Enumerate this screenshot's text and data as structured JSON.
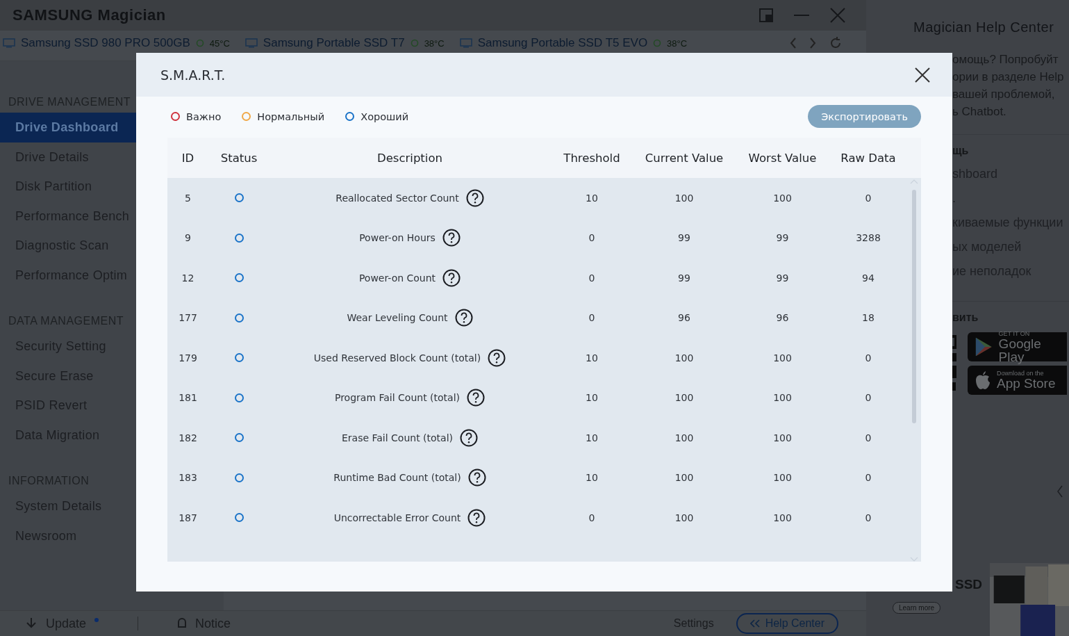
{
  "app": {
    "logo": "SAMSUNG Magician"
  },
  "drives": [
    {
      "name": "Samsung SSD 980 PRO 500GB",
      "temp": "45°C"
    },
    {
      "name": "Samsung Portable SSD T7",
      "temp": "38°C"
    },
    {
      "name": "Samsung Portable SSD T5 EVO",
      "temp": "38°C"
    }
  ],
  "sidebar": [
    {
      "heading": "DRIVE MANAGEMENT",
      "items": [
        {
          "label": "Drive Dashboard",
          "selected": true
        },
        {
          "label": "Drive Details",
          "selected": false
        },
        {
          "label": "Disk Partition",
          "selected": false
        },
        {
          "label": "Performance Bench",
          "selected": false
        },
        {
          "label": "Diagnostic Scan",
          "selected": false
        },
        {
          "label": "Performance Optim",
          "selected": false
        }
      ]
    },
    {
      "heading": "DATA MANAGEMENT",
      "items": [
        {
          "label": "Security Setting",
          "selected": false
        },
        {
          "label": "Secure Erase",
          "selected": false
        },
        {
          "label": "PSID Revert",
          "selected": false
        },
        {
          "label": "Data Migration",
          "selected": false
        }
      ]
    },
    {
      "heading": "INFORMATION",
      "items": [
        {
          "label": "System Details",
          "selected": false
        },
        {
          "label": "Newsroom",
          "selected": false
        }
      ]
    }
  ],
  "bottom_bar": {
    "update": "Update",
    "notice": "Notice",
    "settings": "Settings",
    "help_center": "Help Center"
  },
  "help_panel": {
    "title": "Magician Help Center",
    "intro": [
      "омощь? Попробуйт",
      "ории в разделе Help",
      "вашей проблемой,",
      "ь Chatbot."
    ],
    "section": "щь",
    "links": [
      "shboard",
      ".",
      "киваемые функции",
      "ых моделей",
      "ие неполадок"
    ],
    "install": "вить",
    "google_play": {
      "small": "GET IT ON",
      "big": "Google Play"
    },
    "app_store": {
      "small": "Download on the",
      "big": "App Store"
    },
    "promo": "SSD",
    "learn_more": "Learn more"
  },
  "dialog": {
    "title": "S.M.A.R.T.",
    "legend": [
      {
        "label": "Важно",
        "color": "#d0343f"
      },
      {
        "label": "Нормальный",
        "color": "#f0a848"
      },
      {
        "label": "Хороший",
        "color": "#1a73c8"
      }
    ],
    "export": "Экспортировать",
    "columns": [
      "ID",
      "Status",
      "Description",
      "Threshold",
      "Current Value",
      "Worst Value",
      "Raw Data"
    ],
    "rows": [
      {
        "id": "5",
        "color": "#1a73c8",
        "description": "Reallocated Sector Count",
        "threshold": "10",
        "current": "100",
        "worst": "100",
        "raw": "0"
      },
      {
        "id": "9",
        "color": "#1a73c8",
        "description": "Power-on Hours",
        "threshold": "0",
        "current": "99",
        "worst": "99",
        "raw": "3288"
      },
      {
        "id": "12",
        "color": "#1a73c8",
        "description": "Power-on Count",
        "threshold": "0",
        "current": "99",
        "worst": "99",
        "raw": "94"
      },
      {
        "id": "177",
        "color": "#1a73c8",
        "description": "Wear Leveling Count",
        "threshold": "0",
        "current": "96",
        "worst": "96",
        "raw": "18"
      },
      {
        "id": "179",
        "color": "#1a73c8",
        "description": "Used Reserved Block Count (total)",
        "threshold": "10",
        "current": "100",
        "worst": "100",
        "raw": "0"
      },
      {
        "id": "181",
        "color": "#1a73c8",
        "description": "Program Fail Count (total)",
        "threshold": "10",
        "current": "100",
        "worst": "100",
        "raw": "0"
      },
      {
        "id": "182",
        "color": "#1a73c8",
        "description": "Erase Fail Count (total)",
        "threshold": "10",
        "current": "100",
        "worst": "100",
        "raw": "0"
      },
      {
        "id": "183",
        "color": "#1a73c8",
        "description": "Runtime Bad Count (total)",
        "threshold": "10",
        "current": "100",
        "worst": "100",
        "raw": "0"
      },
      {
        "id": "187",
        "color": "#1a73c8",
        "description": "Uncorrectable Error Count",
        "threshold": "0",
        "current": "100",
        "worst": "100",
        "raw": "0"
      }
    ]
  }
}
